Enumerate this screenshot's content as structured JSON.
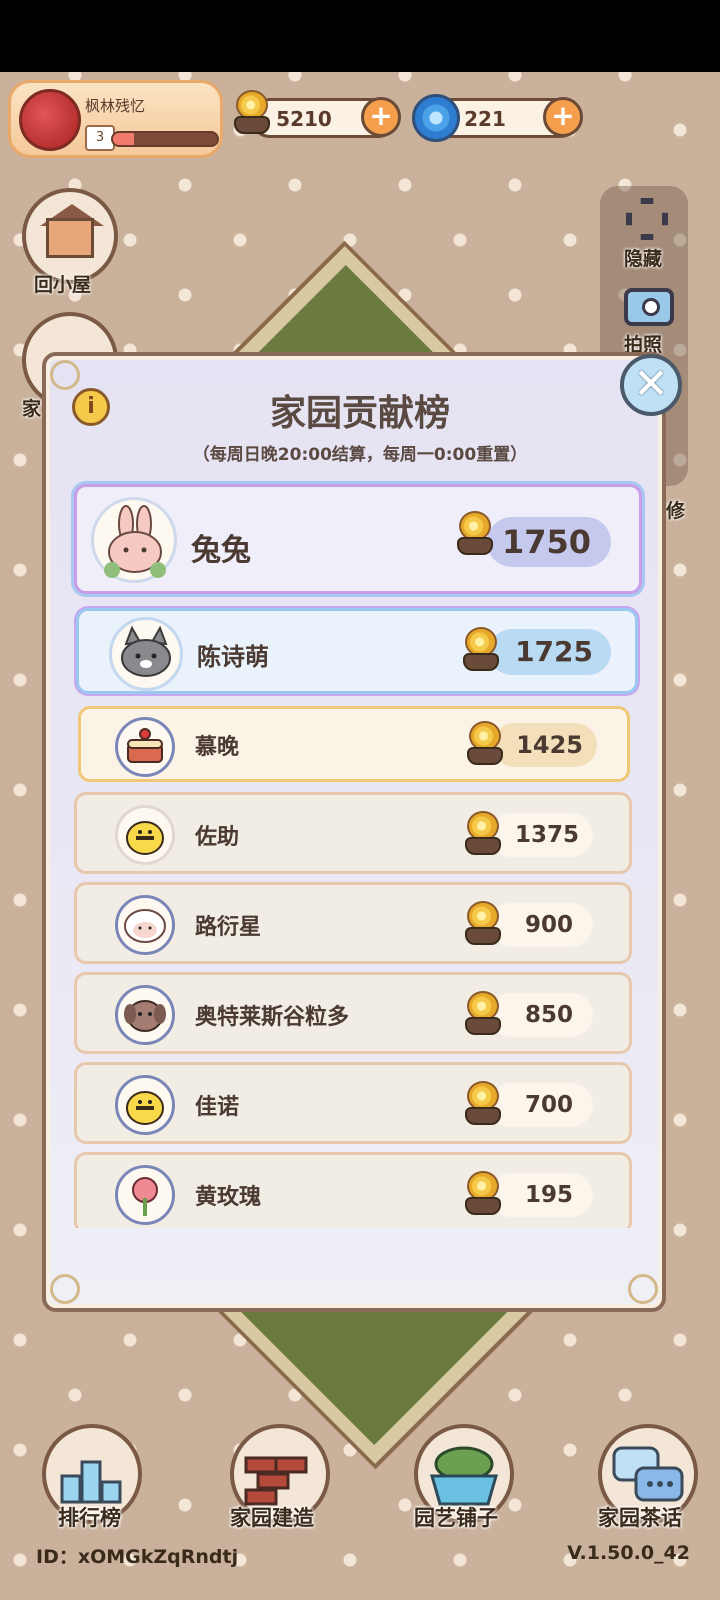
{
  "profile": {
    "name": "枫林残忆",
    "level": "3",
    "level_progress": 0.2
  },
  "currency": {
    "snail_value": "5210",
    "swirl_value": "221",
    "plus": "+"
  },
  "side_buttons": {
    "home": "回小屋",
    "garden_partial": "家"
  },
  "tools": {
    "hide": "隐藏",
    "photo": "拍照",
    "repair_partial": "修"
  },
  "modal": {
    "title": "家园贡献榜",
    "subtitle": "（每周日晚20:00结算，每周一0:00重置）",
    "info": "i",
    "close": "✕"
  },
  "rows": [
    {
      "name": "兔兔",
      "score": "1750",
      "avatar": "rabbit-avatar"
    },
    {
      "name": "陈诗萌",
      "score": "1725",
      "avatar": "cat-avatar"
    },
    {
      "name": "慕晚",
      "score": "1425",
      "avatar": "cake-avatar"
    },
    {
      "name": "佐助",
      "score": "1375",
      "avatar": "bee-avatar"
    },
    {
      "name": "路衍星",
      "score": "900",
      "avatar": "sheep-avatar"
    },
    {
      "name": "奥特莱斯谷粒多",
      "score": "850",
      "avatar": "dog-avatar"
    },
    {
      "name": "佳诺",
      "score": "700",
      "avatar": "bee-avatar"
    },
    {
      "name": "黄玫瑰",
      "score": "195",
      "avatar": "tulip-avatar"
    }
  ],
  "nav": {
    "ranking": "排行榜",
    "build": "家园建造",
    "shop": "园艺铺子",
    "chat": "家园茶话"
  },
  "footer": {
    "id": "ID：xOMGkZqRndtj",
    "version": "V.1.50.0_42"
  }
}
